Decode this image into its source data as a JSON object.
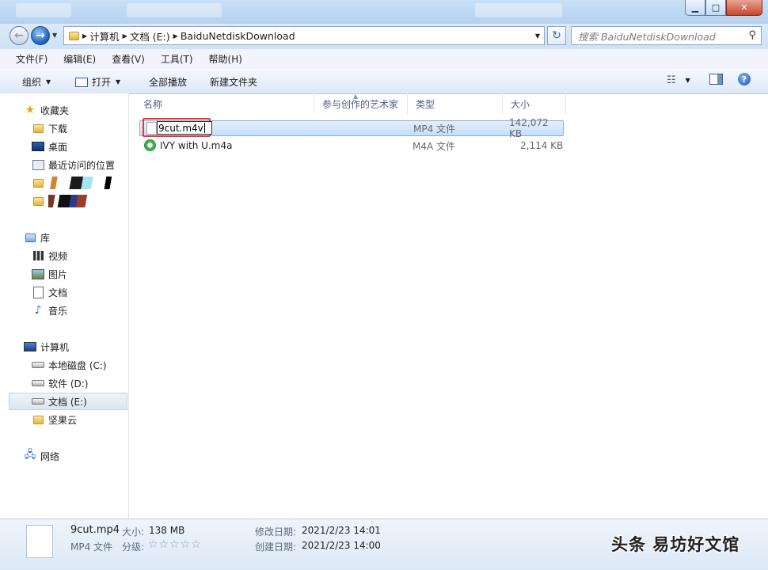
{
  "address": {
    "segments": [
      "计算机",
      "文档 (E:)",
      "BaiduNetdiskDownload"
    ],
    "search_placeholder": "搜索 BaiduNetdiskDownload"
  },
  "menu": [
    "文件(F)",
    "编辑(E)",
    "查看(V)",
    "工具(T)",
    "帮助(H)"
  ],
  "toolbar": {
    "organize": "组织",
    "open": "打开",
    "play_all": "全部播放",
    "new_folder": "新建文件夹"
  },
  "nav": {
    "favorites": "收藏夹",
    "downloads": "下载",
    "desktop": "桌面",
    "recent": "最近访问的位置",
    "libraries": "库",
    "videos": "视频",
    "pictures": "图片",
    "documents": "文档",
    "music": "音乐",
    "computer": "计算机",
    "drive_c": "本地磁盘 (C:)",
    "drive_d": "软件 (D:)",
    "drive_e": "文档 (E:)",
    "jianguoyun": "坚果云",
    "network": "网络"
  },
  "columns": [
    "名称",
    "参与创作的艺术家",
    "类型",
    "大小"
  ],
  "files": [
    {
      "name": "9cut.m4v",
      "type": "MP4 文件",
      "size": "142,072 KB"
    },
    {
      "name": "IVY with U.m4a",
      "type": "M4A 文件",
      "size": "2,114 KB"
    }
  ],
  "details": {
    "filename": "9cut.mp4",
    "size_label": "大小:",
    "size_value": "138 MB",
    "type_value": "MP4 文件",
    "rating_label": "分级:",
    "rating_stars": "☆☆☆☆☆",
    "modified_label": "修改日期:",
    "modified_value": "2021/2/23 14:01",
    "created_label": "创建日期:",
    "created_value": "2021/2/23 14:00"
  },
  "watermark": "头条 易坊好文馆",
  "colors": {
    "accent": "#3a7bd5",
    "selection": "#cfe3fb",
    "rename_highlight": "#e0393e"
  }
}
